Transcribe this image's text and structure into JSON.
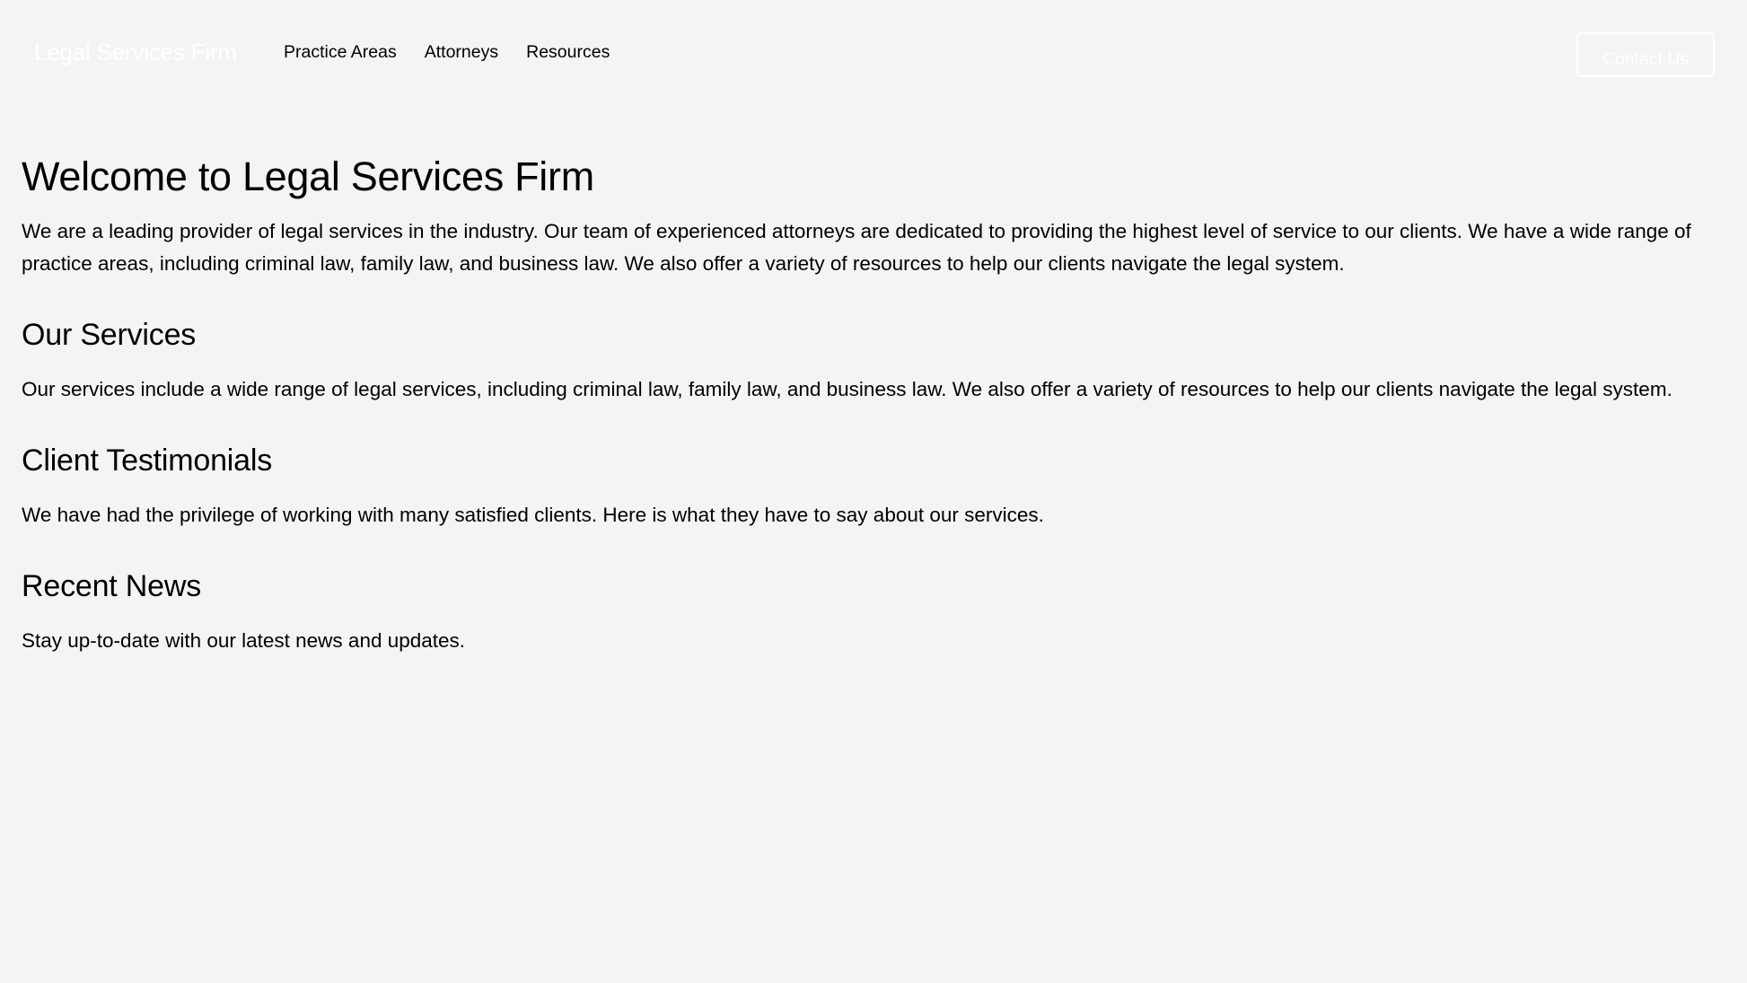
{
  "header": {
    "brand": "Legal Services Firm",
    "nav_links": [
      {
        "label": "Practice Areas"
      },
      {
        "label": "Attorneys"
      },
      {
        "label": "Resources"
      }
    ],
    "contact_button": "Contact Us"
  },
  "main": {
    "title": "Welcome to Legal Services Firm",
    "intro": "We are a leading provider of legal services in the industry. Our team of experienced attorneys are dedicated to providing the highest level of service to our clients. We have a wide range of practice areas, including criminal law, family law, and business law. We also offer a variety of resources to help our clients navigate the legal system.",
    "sections": [
      {
        "heading": "Our Services",
        "text": "Our services include a wide range of legal services, including criminal law, family law, and business law. We also offer a variety of resources to help our clients navigate the legal system."
      },
      {
        "heading": "Client Testimonials",
        "text": "We have had the privilege of working with many satisfied clients. Here is what they have to say about our services."
      },
      {
        "heading": "Recent News",
        "text": "Stay up-to-date with our latest news and updates."
      }
    ]
  },
  "colors": {
    "background": "#f3f4f6",
    "text": "#000000",
    "brand_text": "#ffffff",
    "button_border": "#ffffff"
  }
}
